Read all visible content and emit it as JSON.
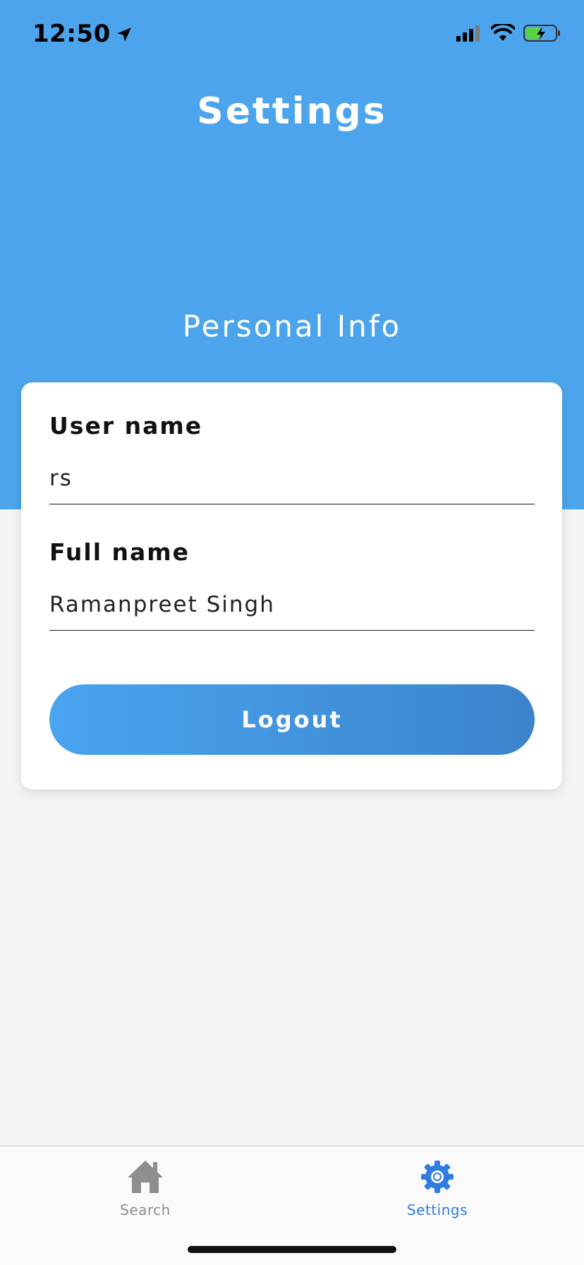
{
  "status_bar": {
    "time": "12:50"
  },
  "header": {
    "title": "Settings",
    "section_title": "Personal Info"
  },
  "form": {
    "username_label": "User name",
    "username_value": "rs",
    "fullname_label": "Full name",
    "fullname_value": "Ramanpreet Singh",
    "logout_label": "Logout"
  },
  "tab_bar": {
    "tabs": [
      {
        "label": "Search",
        "icon": "home-icon",
        "active": false
      },
      {
        "label": "Settings",
        "icon": "gear-icon",
        "active": true
      }
    ]
  },
  "colors": {
    "header_blue": "#4ca5ec",
    "active_tab": "#2f7de0",
    "inactive_tab": "#8e8e8e",
    "button_gradient_start": "#4aa4ef",
    "button_gradient_end": "#3b84cc"
  }
}
